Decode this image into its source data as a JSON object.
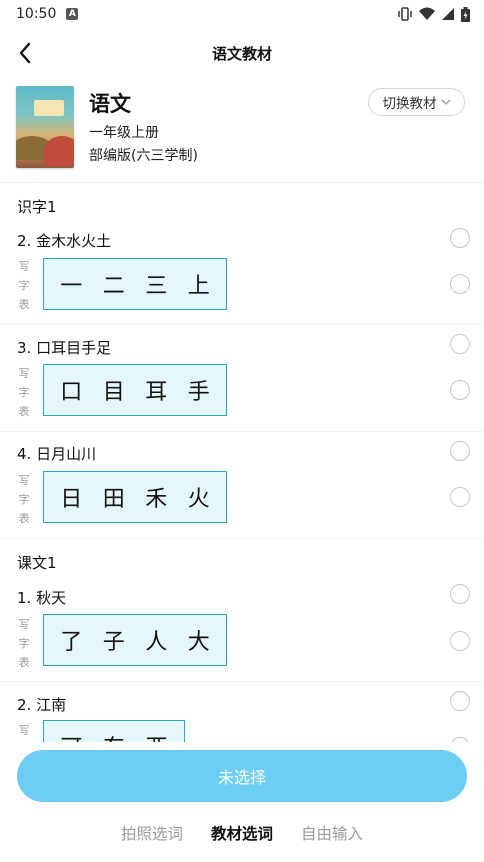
{
  "status_bar": {
    "time": "10:50",
    "notif_letter": "A"
  },
  "header": {
    "title": "语文教材"
  },
  "book": {
    "name": "语文",
    "grade": "一年级上册",
    "edition": "部编版(六三学制)",
    "switch_label": "切换教材"
  },
  "vertical_label": [
    "写",
    "字",
    "表"
  ],
  "sections": [
    {
      "title": "识字1",
      "lessons": [
        {
          "title": "2. 金木水火土",
          "chars": [
            "一",
            "二",
            "三",
            "上"
          ]
        },
        {
          "title": "3. 口耳目手足",
          "chars": [
            "口",
            "目",
            "耳",
            "手"
          ]
        },
        {
          "title": "4. 日月山川",
          "chars": [
            "日",
            "田",
            "禾",
            "火"
          ]
        }
      ]
    },
    {
      "title": "课文1",
      "lessons": [
        {
          "title": "1. 秋天",
          "chars": [
            "了",
            "子",
            "人",
            "大"
          ]
        },
        {
          "title": "2. 江南",
          "chars": [
            "可",
            "东",
            "西"
          ]
        }
      ]
    }
  ],
  "bottom": {
    "button_label": "未选择",
    "tabs": [
      "拍照选词",
      "教材选词",
      "自由输入"
    ],
    "active_tab": "教材选词"
  },
  "colors": {
    "accent_button": "#6dcdf2",
    "char_box_border": "#28a6c2",
    "char_box_bg": "#e6f7fc"
  }
}
